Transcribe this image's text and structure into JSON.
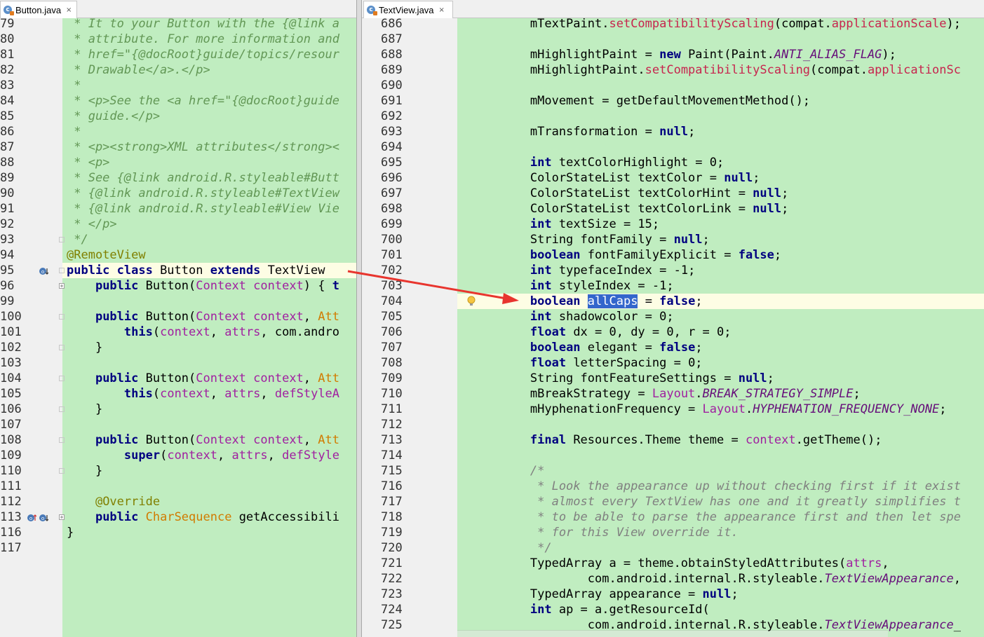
{
  "left_editor": {
    "tab_label": "Button.java",
    "tab_close": "×",
    "lines": [
      {
        "n": "79",
        "html": "<span class='doc'> * It to your Button with the {@link a</span>"
      },
      {
        "n": "80",
        "html": "<span class='doc'> * attribute. For more information and</span>"
      },
      {
        "n": "81",
        "html": "<span class='doc'> * href=\"{@docRoot}guide/topics/resour</span>"
      },
      {
        "n": "82",
        "html": "<span class='doc'> * Drawable&lt;/a&gt;.&lt;/p&gt;</span>"
      },
      {
        "n": "83",
        "html": "<span class='doc'> *</span>"
      },
      {
        "n": "84",
        "html": "<span class='doc'> * &lt;p&gt;See the &lt;a href=\"{@docRoot}guide</span>"
      },
      {
        "n": "85",
        "html": "<span class='doc'> * guide.&lt;/p&gt;</span>"
      },
      {
        "n": "86",
        "html": "<span class='doc'> *</span>"
      },
      {
        "n": "87",
        "html": "<span class='doc'> * &lt;p&gt;&lt;strong&gt;XML attributes&lt;/strong&gt;&lt;</span>"
      },
      {
        "n": "88",
        "html": "<span class='doc'> * &lt;p&gt;</span>"
      },
      {
        "n": "89",
        "html": "<span class='doc'> * See {@link android.R.styleable#Butt</span>"
      },
      {
        "n": "90",
        "html": "<span class='doc'> * {@link android.R.styleable#TextView</span>"
      },
      {
        "n": "91",
        "html": "<span class='doc'> * {@link android.R.styleable#View Vie</span>"
      },
      {
        "n": "92",
        "html": "<span class='doc'> * &lt;/p&gt;</span>"
      },
      {
        "n": "93",
        "html": "<span class='doc'> */</span>"
      },
      {
        "n": "94",
        "html": "<span class='anno'>@RemoteView</span>"
      },
      {
        "n": "95",
        "html": "<span class='kw'>public class</span> Button <span class='kw'>extends</span> TextView"
      },
      {
        "n": "96",
        "html": "    <span class='kw'>public</span> Button(<span class='param'>Context context</span>) { <span class='kw'>t</span>"
      },
      {
        "n": "99",
        "html": ""
      },
      {
        "n": "100",
        "html": "    <span class='kw'>public</span> Button(<span class='param'>Context context</span>, <span class='type-orange'>Att</span>"
      },
      {
        "n": "101",
        "html": "        <span class='kw'>this</span>(<span class='param'>context</span>, <span class='param'>attrs</span>, com.andro"
      },
      {
        "n": "102",
        "html": "    }"
      },
      {
        "n": "103",
        "html": ""
      },
      {
        "n": "104",
        "html": "    <span class='kw'>public</span> Button(<span class='param'>Context context</span>, <span class='type-orange'>Att</span>"
      },
      {
        "n": "105",
        "html": "        <span class='kw'>this</span>(<span class='param'>context</span>, <span class='param'>attrs</span>, <span class='param'>defStyleA</span>"
      },
      {
        "n": "106",
        "html": "    }"
      },
      {
        "n": "107",
        "html": ""
      },
      {
        "n": "108",
        "html": "    <span class='kw'>public</span> Button(<span class='param'>Context context</span>, <span class='type-orange'>Att</span>"
      },
      {
        "n": "109",
        "html": "        <span class='kw'>super</span>(<span class='param'>context</span>, <span class='param'>attrs</span>, <span class='param'>defStyle</span>"
      },
      {
        "n": "110",
        "html": "    }"
      },
      {
        "n": "111",
        "html": ""
      },
      {
        "n": "112",
        "html": "    <span class='anno'>@Override</span>"
      },
      {
        "n": "113",
        "html": "    <span class='kw'>public</span> <span class='type-orange'>CharSequence</span> getAccessibili"
      },
      {
        "n": "116",
        "html": "}"
      },
      {
        "n": "117",
        "html": ""
      }
    ]
  },
  "right_editor": {
    "tab_label": "TextView.java",
    "tab_close": "×",
    "lines": [
      {
        "n": "686",
        "html": "        mTextPaint.<span class='method-red'>setCompatibilityScaling</span>(compat.<span class='method-red'>applicationScale</span>);"
      },
      {
        "n": "687",
        "html": ""
      },
      {
        "n": "688",
        "html": "        mHighlightPaint = <span class='kw'>new</span> Paint(Paint.<span class='italic-field'>ANTI_ALIAS_FLAG</span>);"
      },
      {
        "n": "689",
        "html": "        mHighlightPaint.<span class='method-red'>setCompatibilityScaling</span>(compat.<span class='method-red'>applicationSc</span>"
      },
      {
        "n": "690",
        "html": ""
      },
      {
        "n": "691",
        "html": "        mMovement = getDefaultMovementMethod();"
      },
      {
        "n": "692",
        "html": ""
      },
      {
        "n": "693",
        "html": "        mTransformation = <span class='kw'>null</span>;"
      },
      {
        "n": "694",
        "html": ""
      },
      {
        "n": "695",
        "html": "        <span class='kw'>int</span> textColorHighlight = 0;"
      },
      {
        "n": "696",
        "html": "        ColorStateList textColor = <span class='kw'>null</span>;"
      },
      {
        "n": "697",
        "html": "        ColorStateList textColorHint = <span class='kw'>null</span>;"
      },
      {
        "n": "698",
        "html": "        ColorStateList textColorLink = <span class='kw'>null</span>;"
      },
      {
        "n": "699",
        "html": "        <span class='kw'>int</span> textSize = 15;"
      },
      {
        "n": "700",
        "html": "        String fontFamily = <span class='kw'>null</span>;"
      },
      {
        "n": "701",
        "html": "        <span class='kw'>boolean</span> fontFamilyExplicit = <span class='kw'>false</span>;"
      },
      {
        "n": "702",
        "html": "        <span class='kw'>int</span> typefaceIndex = -1;"
      },
      {
        "n": "703",
        "html": "        <span class='kw'>int</span> styleIndex = -1;"
      },
      {
        "n": "704",
        "html": "        <span class='kw'>boolean</span> <span class='sel'>allCaps</span> = <span class='kw'>false</span>;"
      },
      {
        "n": "705",
        "html": "        <span class='kw'>int</span> shadowcolor = 0;"
      },
      {
        "n": "706",
        "html": "        <span class='kw'>float</span> dx = 0, dy = 0, r = 0;"
      },
      {
        "n": "707",
        "html": "        <span class='kw'>boolean</span> elegant = <span class='kw'>false</span>;"
      },
      {
        "n": "708",
        "html": "        <span class='kw'>float</span> letterSpacing = 0;"
      },
      {
        "n": "709",
        "html": "        String fontFeatureSettings = <span class='kw'>null</span>;"
      },
      {
        "n": "710",
        "html": "        mBreakStrategy = <span class='param'>Layout</span>.<span class='italic-field'>BREAK_STRATEGY_SIMPLE</span>;"
      },
      {
        "n": "711",
        "html": "        mHyphenationFrequency = <span class='param'>Layout</span>.<span class='italic-field'>HYPHENATION_FREQUENCY_NONE</span>;"
      },
      {
        "n": "712",
        "html": ""
      },
      {
        "n": "713",
        "html": "        <span class='kw'>final</span> Resources.Theme theme = <span class='param'>context</span>.getTheme();"
      },
      {
        "n": "714",
        "html": ""
      },
      {
        "n": "715",
        "html": "        <span class='com'>/*</span>"
      },
      {
        "n": "716",
        "html": "<span class='com'>         * Look the appearance up without checking first if it exist</span>"
      },
      {
        "n": "717",
        "html": "<span class='com'>         * almost every TextView has one and it greatly simplifies t</span>"
      },
      {
        "n": "718",
        "html": "<span class='com'>         * to be able to parse the appearance first and then let spe</span>"
      },
      {
        "n": "719",
        "html": "<span class='com'>         * for this View override it.</span>"
      },
      {
        "n": "720",
        "html": "<span class='com'>         */</span>"
      },
      {
        "n": "721",
        "html": "        TypedArray a = theme.obtainStyledAttributes(<span class='param'>attrs</span>,"
      },
      {
        "n": "722",
        "html": "                com.android.internal.R.styleable.<span class='italic-field'>TextViewAppearance</span>,"
      },
      {
        "n": "723",
        "html": "        TypedArray appearance = <span class='kw'>null</span>;"
      },
      {
        "n": "724",
        "html": "        <span class='kw'>int</span> ap = a.getResourceId("
      },
      {
        "n": "725",
        "html": "                com.android.internal.R.styleable.<span class='italic-field'>TextViewAppearance</span>_"
      }
    ]
  },
  "colors": {
    "code_bg": "#c0edc0",
    "gutter_bg": "#f0f0f0",
    "current_line": "#fdfde4",
    "arrow": "#e8352e",
    "selection": "#3366cc"
  },
  "icons": {
    "tab_icon": "java-class-icon",
    "override_icon": "override-gutter-icon",
    "bulb_icon": "intention-bulb-icon",
    "arrow": "red-annotation-arrow"
  }
}
